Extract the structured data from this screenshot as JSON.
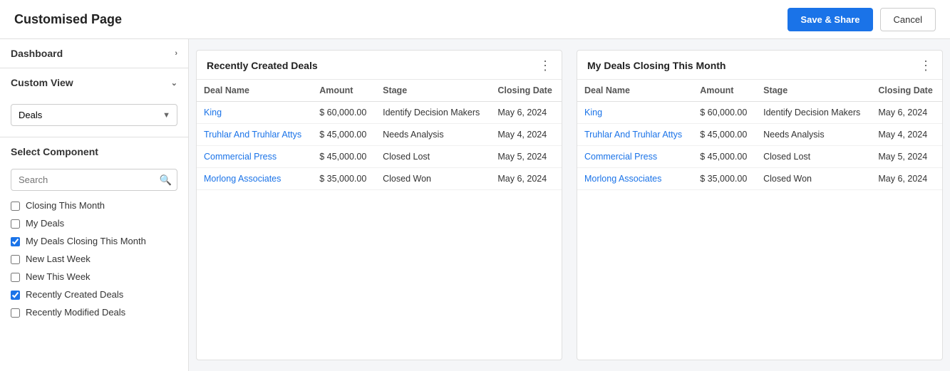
{
  "header": {
    "title": "Customised Page",
    "save_share_label": "Save & Share",
    "cancel_label": "Cancel"
  },
  "sidebar": {
    "dashboard_label": "Dashboard",
    "custom_view_label": "Custom View",
    "select_component_label": "Select Component",
    "deals_option": "Deals",
    "search_placeholder": "Search",
    "components": [
      {
        "id": "closing_this_month",
        "label": "Closing This Month",
        "checked": false
      },
      {
        "id": "my_deals",
        "label": "My Deals",
        "checked": false
      },
      {
        "id": "my_deals_closing_this_month",
        "label": "My Deals Closing This Month",
        "checked": true
      },
      {
        "id": "new_last_week",
        "label": "New Last Week",
        "checked": false
      },
      {
        "id": "new_this_week",
        "label": "New This Week",
        "checked": false
      },
      {
        "id": "recently_created_deals",
        "label": "Recently Created Deals",
        "checked": true
      },
      {
        "id": "recently_modified_deals",
        "label": "Recently Modified Deals",
        "checked": false
      }
    ]
  },
  "panels": [
    {
      "id": "recently_created_deals",
      "title": "Recently Created Deals",
      "columns": [
        "Deal Name",
        "Amount",
        "Stage",
        "Closing Date"
      ],
      "rows": [
        {
          "name": "King",
          "amount": "$ 60,000.00",
          "stage": "Identify Decision Makers",
          "closing_date": "May 6, 2024"
        },
        {
          "name": "Truhlar And Truhlar Attys",
          "amount": "$ 45,000.00",
          "stage": "Needs Analysis",
          "closing_date": "May 4, 2024"
        },
        {
          "name": "Commercial Press",
          "amount": "$ 45,000.00",
          "stage": "Closed Lost",
          "closing_date": "May 5, 2024"
        },
        {
          "name": "Morlong Associates",
          "amount": "$ 35,000.00",
          "stage": "Closed Won",
          "closing_date": "May 6, 2024"
        }
      ]
    },
    {
      "id": "my_deals_closing_this_month",
      "title": "My Deals Closing This Month",
      "columns": [
        "Deal Name",
        "Amount",
        "Stage",
        "Closing Date"
      ],
      "rows": [
        {
          "name": "King",
          "amount": "$ 60,000.00",
          "stage": "Identify Decision Makers",
          "closing_date": "May 6, 2024"
        },
        {
          "name": "Truhlar And Truhlar Attys",
          "amount": "$ 45,000.00",
          "stage": "Needs Analysis",
          "closing_date": "May 4, 2024"
        },
        {
          "name": "Commercial Press",
          "amount": "$ 45,000.00",
          "stage": "Closed Lost",
          "closing_date": "May 5, 2024"
        },
        {
          "name": "Morlong Associates",
          "amount": "$ 35,000.00",
          "stage": "Closed Won",
          "closing_date": "May 6, 2024"
        }
      ]
    }
  ]
}
